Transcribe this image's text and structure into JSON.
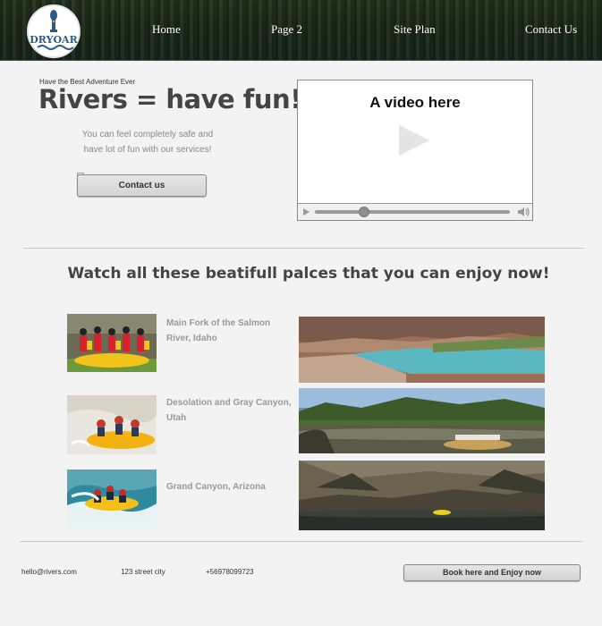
{
  "header": {
    "logo_text": "DRYOAR",
    "nav": [
      {
        "label": "Home"
      },
      {
        "label": "Page 2"
      },
      {
        "label": "Site Plan"
      },
      {
        "label": "Contact Us"
      }
    ]
  },
  "hero": {
    "eyebrow": "Have the Best Adventure Ever",
    "title": "Rivers = have fun!",
    "subtitle": "You can feel completely safe and have lot of fun with our services!",
    "contact_label": "Contact us"
  },
  "video": {
    "label": "A video here",
    "progress": 0.25
  },
  "section": {
    "title": "Watch all these beatifull palces that you can enjoy now!",
    "places": [
      {
        "name": "Main Fork of the Salmon River, Idaho"
      },
      {
        "name": "Desolation and Gray Canyon, Utah"
      },
      {
        "name": "Grand Canyon, Arizona"
      }
    ]
  },
  "footer": {
    "email": "hello@rivers.com",
    "address": "123 street city",
    "phone": "+56978099723",
    "book_label": "Book here and Enjoy now"
  },
  "colors": {
    "header_bg": "#1d2d1a",
    "page_bg": "#f3f3f3",
    "logo_blue": "#2d5b86",
    "heading": "#444444",
    "muted_text": "#999999"
  }
}
